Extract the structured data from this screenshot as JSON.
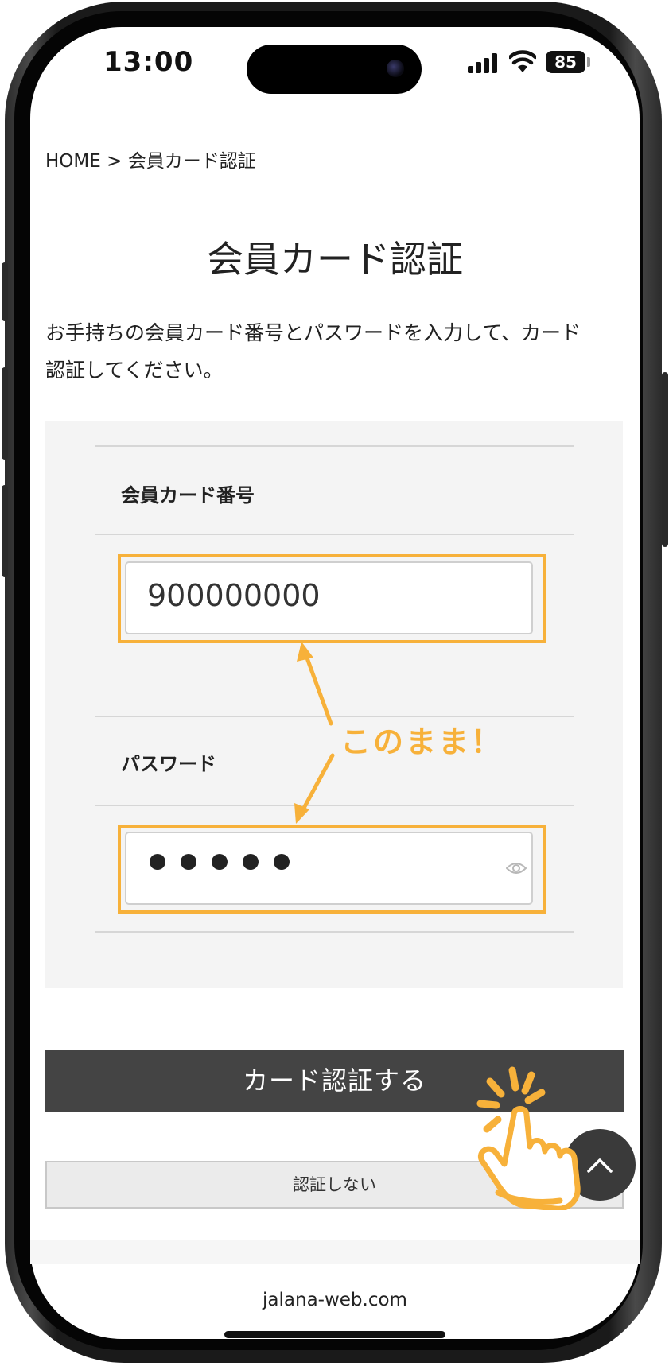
{
  "status_bar": {
    "time": "13:00",
    "battery": "85",
    "signal_icon": "cellular-signal-icon",
    "wifi_icon": "wifi-icon"
  },
  "breadcrumb": {
    "home": "HOME",
    "separator": ">",
    "current": "会員カード認証"
  },
  "page": {
    "title": "会員カード認証",
    "description_line1": "お手持ちの会員カード番号とパスワードを入力して、カード",
    "description_line2": "認証してください。"
  },
  "form": {
    "card_number_label": "会員カード番号",
    "card_number_value": "900000000",
    "password_label": "パスワード",
    "password_dot_count": 5,
    "password_toggle_icon": "eye-icon"
  },
  "annotation": {
    "text": "このまま！",
    "color": "#f7b13a"
  },
  "buttons": {
    "submit_label": "カード認証する",
    "skip_label": "認証しない",
    "scroll_top_icon": "chevron-up-icon",
    "tap_icon": "tap-hand-icon"
  },
  "footer": {
    "site": "jalana-web.com"
  },
  "colors": {
    "accent": "#f7b13a",
    "button_dark": "#444444",
    "panel_bg": "#f4f4f4"
  }
}
